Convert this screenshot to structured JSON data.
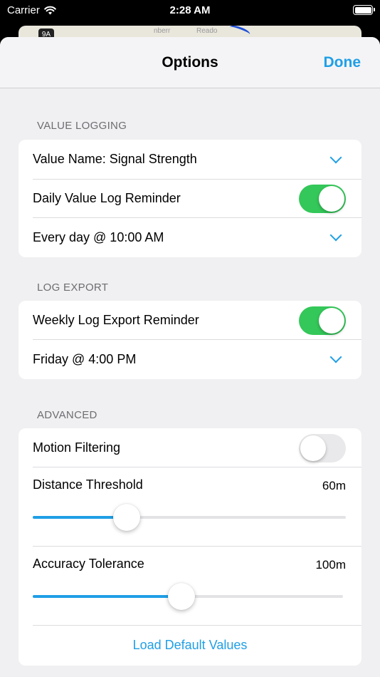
{
  "status_bar": {
    "carrier": "Carrier",
    "time": "2:28 AM",
    "wifi_icon": "wifi-icon",
    "battery_icon": "battery-icon"
  },
  "map_peek": {
    "badge": "9A",
    "labels": [
      "nberr",
      "Reado"
    ],
    "route_color": "#1f4fd9"
  },
  "nav": {
    "title": "Options",
    "done_label": "Done"
  },
  "colors": {
    "accent": "#1f9fe6",
    "toggle_on": "#34c759",
    "toggle_off": "#e9e9eb"
  },
  "sections": {
    "value_logging": {
      "header": "VALUE LOGGING",
      "value_name": "Value Name:  Signal Strength",
      "daily_reminder_label": "Daily Value Log Reminder",
      "daily_reminder_on": true,
      "daily_schedule": "Every day @ 10:00 AM"
    },
    "log_export": {
      "header": "LOG EXPORT",
      "weekly_reminder_label": "Weekly Log Export Reminder",
      "weekly_reminder_on": true,
      "weekly_schedule": "Friday @ 4:00 PM"
    },
    "advanced": {
      "header": "ADVANCED",
      "motion_filtering_label": "Motion Filtering",
      "motion_filtering_on": false,
      "distance_threshold": {
        "label": "Distance Threshold",
        "value_text": "60m",
        "fraction": 0.3
      },
      "accuracy_tolerance": {
        "label": "Accuracy Tolerance",
        "value_text": "100m",
        "fraction": 0.48
      },
      "load_defaults_label": "Load Default Values"
    }
  }
}
